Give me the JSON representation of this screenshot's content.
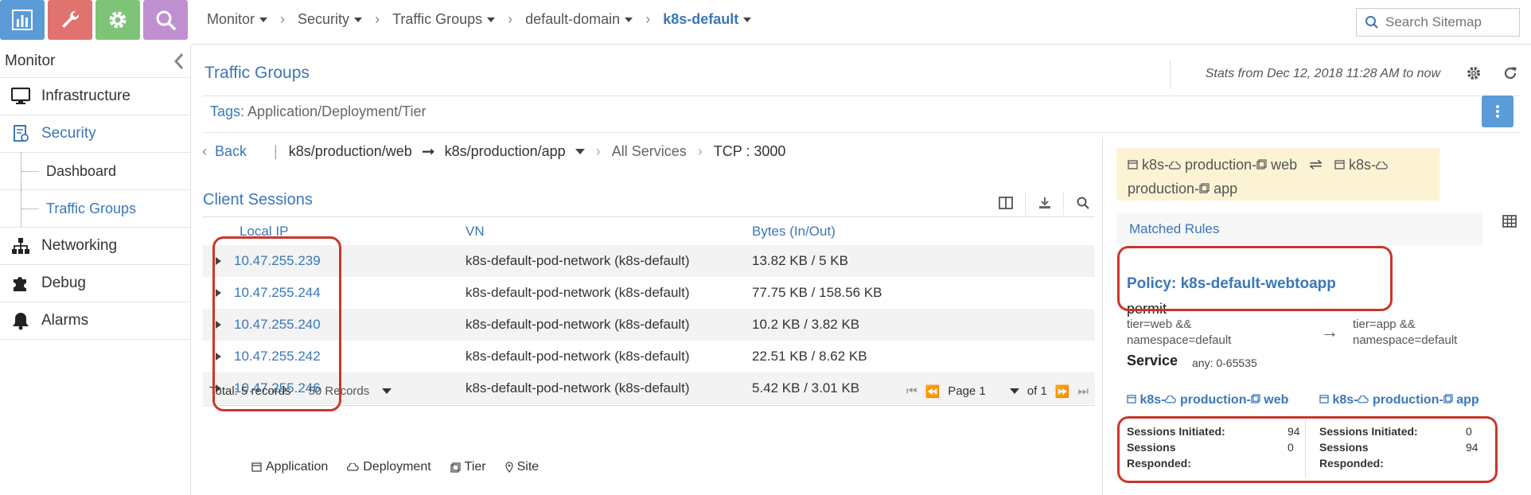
{
  "app_switcher": [
    {
      "name": "monitor",
      "icon": "bar-chart-icon",
      "color": "#5a9bd8"
    },
    {
      "name": "configure",
      "icon": "wrench-icon",
      "color": "#e0726f"
    },
    {
      "name": "settings",
      "icon": "gear-icon",
      "color": "#7fc379"
    },
    {
      "name": "query",
      "icon": "search-icon",
      "color": "#c08fd0"
    }
  ],
  "breadcrumb": {
    "items": [
      "Monitor",
      "Security",
      "Traffic Groups",
      "default-domain",
      "k8s-default"
    ]
  },
  "search": {
    "placeholder": "Search Sitemap"
  },
  "sidebar": {
    "title": "Monitor",
    "items": [
      {
        "label": "Infrastructure",
        "icon": "monitor-icon"
      },
      {
        "label": "Security",
        "icon": "security-doc-icon"
      },
      {
        "label": "Dashboard"
      },
      {
        "label": "Traffic Groups"
      },
      {
        "label": "Networking",
        "icon": "network-icon"
      },
      {
        "label": "Debug",
        "icon": "puzzle-icon"
      },
      {
        "label": "Alarms",
        "icon": "bell-icon"
      }
    ]
  },
  "main": {
    "title": "Traffic Groups",
    "stats": "Stats from Dec 12, 2018 11:28 AM to now",
    "tags_label": "Tags:",
    "tags_value": "Application/Deployment/Tier",
    "nav": {
      "back": "Back",
      "source": "k8s/production/web",
      "dest": "k8s/production/app",
      "services": "All Services",
      "protocol": "TCP : 3000"
    }
  },
  "client_sessions": {
    "title": "Client Sessions",
    "columns": [
      "Local IP",
      "VN",
      "Bytes (In/Out)"
    ],
    "rows": [
      {
        "ip": "10.47.255.239",
        "vn": "k8s-default-pod-network (k8s-default)",
        "bytes": "13.82 KB / 5 KB"
      },
      {
        "ip": "10.47.255.244",
        "vn": "k8s-default-pod-network (k8s-default)",
        "bytes": "77.75 KB / 158.56 KB"
      },
      {
        "ip": "10.47.255.240",
        "vn": "k8s-default-pod-network (k8s-default)",
        "bytes": "10.2 KB / 3.82 KB"
      },
      {
        "ip": "10.47.255.242",
        "vn": "k8s-default-pod-network (k8s-default)",
        "bytes": "22.51 KB / 8.62 KB"
      },
      {
        "ip": "10.47.255.246",
        "vn": "k8s-default-pod-network (k8s-default)",
        "bytes": "5.42 KB / 3.01 KB"
      }
    ],
    "total": "Total: 5 records",
    "page_size": "50 Records",
    "page": "Page 1",
    "of": "of 1"
  },
  "legend": [
    "Application",
    "Deployment",
    "Tier",
    "Site"
  ],
  "right_panel": {
    "header_line1": "k8s-  production-  web",
    "header_src_app": "k8s-",
    "header_src_dep": "production-",
    "header_src_tier": "web",
    "header_dst_app": "k8s-",
    "header_dst_dep": "production-",
    "header_dst_tier": "app",
    "matched_rules": "Matched Rules",
    "policy": "Policy: k8s-default-webtoapp",
    "action": "permit",
    "src_cond_1": "tier=web &&",
    "src_cond_2": "namespace=default",
    "dst_cond_1": "tier=app &&",
    "dst_cond_2": "namespace=default",
    "service_label": "Service",
    "service_value": "any: 0-65535",
    "src_endpoint": {
      "app": "k8s-",
      "dep": "production-",
      "tier": "web"
    },
    "dst_endpoint": {
      "app": "k8s-",
      "dep": "production-",
      "tier": "app"
    },
    "src_sessions": {
      "initiated_label": "Sessions Initiated:",
      "initiated": "94",
      "responded_label_1": "Sessions",
      "responded_label_2": "Responded:",
      "responded": "0"
    },
    "dst_sessions": {
      "initiated_label": "Sessions Initiated:",
      "initiated": "0",
      "responded_label_1": "Sessions",
      "responded_label_2": "Responded:",
      "responded": "94"
    }
  },
  "colors": {
    "accent": "#3b77b7",
    "highlight": "#c9372c",
    "header_bg": "#fbf3d4"
  }
}
